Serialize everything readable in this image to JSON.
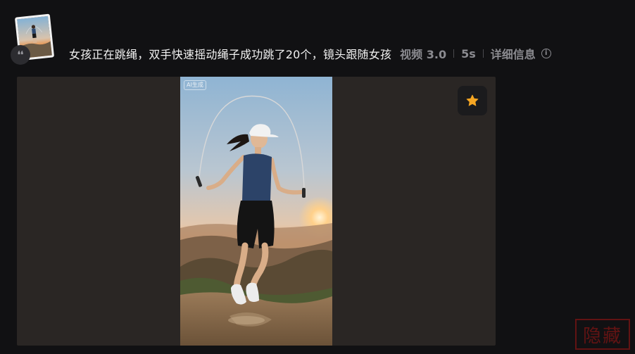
{
  "prompt": {
    "text": "女孩正在跳绳，双手快速摇动绳子成功跳了20个，镜头跟随女孩",
    "model": "视频 3.0",
    "duration": "5s",
    "details_label": "详细信息"
  },
  "video": {
    "ai_tag": "AI生成"
  },
  "icons": {
    "quote": "quote-icon",
    "info": "info-icon",
    "favorite": "star-icon"
  },
  "colors": {
    "background": "#111113",
    "player_bg": "#2a2624",
    "star": "#f5a623",
    "seal": "#6b1414"
  },
  "watermark": {
    "text": "隐藏"
  }
}
